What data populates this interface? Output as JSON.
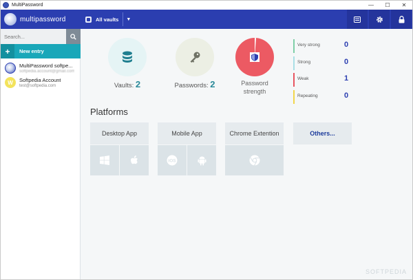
{
  "window": {
    "title": "MultiPassword",
    "controls": {
      "minimize": "—",
      "maximize": "☐",
      "close": "✕"
    }
  },
  "header": {
    "brand": "multipassword",
    "vault_selector": "All vaults",
    "buttons": [
      "list-icon",
      "gear-icon",
      "lock-icon"
    ],
    "accent": "#2b3eb0"
  },
  "sidebar": {
    "search_placeholder": "Search...",
    "new_entry_label": "New entry",
    "entries": [
      {
        "title": "MultiPassword softpe...",
        "subtitle": "softpedia.account@gmail.com",
        "avatar": "globe-icon"
      },
      {
        "title": "Softpedia Account",
        "subtitle": "test@softpedia.com",
        "avatar_letter": "W"
      }
    ]
  },
  "stats": {
    "vaults_label": "Vaults:",
    "vaults_count": "2",
    "passwords_label": "Passwords:",
    "passwords_count": "2",
    "strength_label_1": "Password",
    "strength_label_2": "strength"
  },
  "strength_levels": [
    {
      "name": "Very strong",
      "count": "0",
      "color": "#7fcfa7"
    },
    {
      "name": "Strong",
      "count": "0",
      "color": "#a9dfe6"
    },
    {
      "name": "Weak",
      "count": "1",
      "color": "#e8545f"
    },
    {
      "name": "Repeating",
      "count": "0",
      "color": "#f2d64b"
    }
  ],
  "platforms": {
    "title": "Platforms",
    "cards": [
      {
        "name": "Desktop App",
        "icons": [
          "windows-icon",
          "apple-icon"
        ]
      },
      {
        "name": "Mobile App",
        "icons": [
          "ios-icon",
          "android-icon"
        ]
      },
      {
        "name": "Chrome Extention",
        "icons": [
          "chrome-icon"
        ]
      },
      {
        "name": "Others..."
      }
    ]
  },
  "watermark": "SOFTPEDIA"
}
